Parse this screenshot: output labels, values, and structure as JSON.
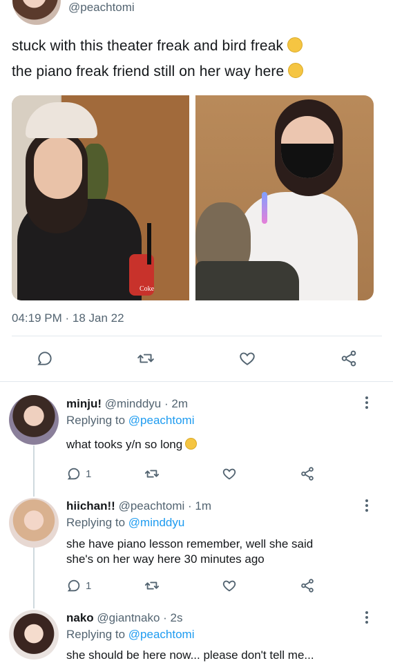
{
  "tweet": {
    "handle": "@peachtomi",
    "text_line1": "stuck with this theater freak and bird freak",
    "text_line2": "the piano freak friend still on her way here",
    "timestamp": "04:19 PM · 18 Jan 22",
    "photo_text": "Coke"
  },
  "replies": [
    {
      "name": "minju!",
      "handle": "@minddyu",
      "time": "· 2m",
      "replying_prefix": "Replying to",
      "replying_to": "@peachtomi",
      "body": "what tooks y/n so long",
      "reply_count": "1"
    },
    {
      "name": "hiichan!!",
      "handle": "@peachtomi",
      "time": "· 1m",
      "replying_prefix": "Replying to",
      "replying_to": "@minddyu",
      "body_line1": "she have piano lesson remember, well she said",
      "body_line2": "she's on her way here 30 minutes ago",
      "reply_count": "1"
    },
    {
      "name": "nako",
      "handle": "@giantnako",
      "time": "· 2s",
      "replying_prefix": "Replying to",
      "replying_to": "@peachtomi",
      "body": "she should be here now... please don't tell me..."
    }
  ],
  "icons": {
    "reply": "comment-icon",
    "retweet": "retweet-icon",
    "like": "heart-icon",
    "share": "share-icon",
    "more": "more-icon"
  },
  "colors": {
    "text": "#14171a",
    "muted": "#536471",
    "link": "#1d9bf0",
    "divider": "#e1e8ed"
  }
}
